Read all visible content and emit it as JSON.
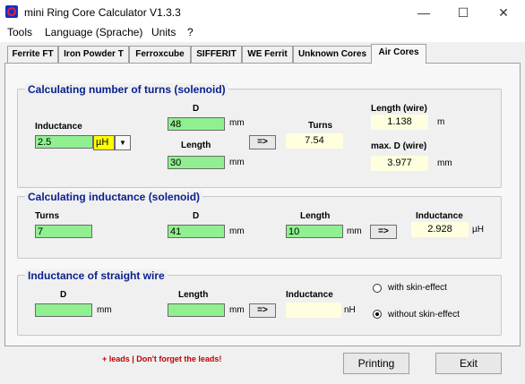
{
  "window": {
    "title": "mini Ring Core Calculator V1.3.3",
    "minimize_glyph": "—",
    "maximize_glyph": "☐",
    "close_glyph": "✕"
  },
  "menu": [
    "Tools",
    "Language (Sprache)",
    "Units",
    "?"
  ],
  "tabs": [
    "Ferrite FT",
    "Iron Powder T",
    "Ferroxcube",
    "SIFFERIT",
    "WE Ferrit",
    "Unknown Cores",
    "Air Cores"
  ],
  "active_tab": "Air Cores",
  "turns_group": {
    "title": "Calculating number of turns (solenoid)",
    "inductance_label": "Inductance",
    "inductance_value": "2.5",
    "unit_select": "µH",
    "d_label": "D",
    "d_value": "48",
    "d_unit": "mm",
    "length_label": "Length",
    "length_value": "30",
    "length_unit": "mm",
    "calc_button": "=>",
    "turns_label": "Turns",
    "turns_value": "7.54",
    "wire_length_label": "Length (wire)",
    "wire_length_value": "1.138",
    "wire_length_unit": "m",
    "maxd_label": "max. D (wire)",
    "maxd_value": "3.977",
    "maxd_unit": "mm"
  },
  "inductance_group": {
    "title": "Calculating inductance (solenoid)",
    "turns_label": "Turns",
    "turns_value": "7",
    "d_label": "D",
    "d_value": "41",
    "d_unit": "mm",
    "length_label": "Length",
    "length_value": "10",
    "length_unit": "mm",
    "calc_button": "=>",
    "inductance_label": "Inductance",
    "inductance_value": "2.928",
    "inductance_unit": "µH"
  },
  "wire_group": {
    "title": "Inductance of straight wire",
    "d_label": "D",
    "d_value": "",
    "d_unit": "mm",
    "length_label": "Length",
    "length_value": "",
    "length_unit": "mm",
    "calc_button": "=>",
    "inductance_label": "Inductance",
    "inductance_value": "",
    "inductance_unit": "nH",
    "option_skin": "with skin-effect",
    "option_no_skin": "without skin-effect",
    "selected_option": "without skin-effect"
  },
  "footer": {
    "leads_note": "+ leads | Don't forget the leads!",
    "printing_button": "Printing",
    "exit_button": "Exit"
  },
  "colors": {
    "input_green": "#90f090",
    "output_yellow": "#ffffe0",
    "group_title_blue": "#0a1e8c",
    "leads_red": "#c00000",
    "unit_select_yellow": "#ffff00"
  }
}
